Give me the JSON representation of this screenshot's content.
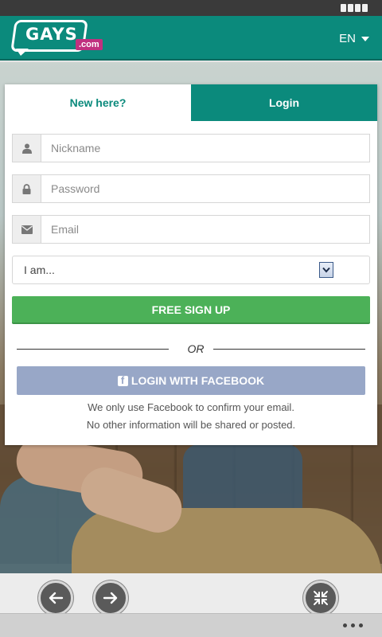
{
  "header": {
    "logo_text": "GAYS",
    "logo_suffix": ".com",
    "language": "EN"
  },
  "tabs": {
    "new_here": "New here?",
    "login": "Login"
  },
  "form": {
    "nickname_placeholder": "Nickname",
    "password_placeholder": "Password",
    "email_placeholder": "Email",
    "iam_selected": "I am...",
    "signup_label": "FREE SIGN UP",
    "or_label": "OR",
    "facebook_label": "LOGIN WITH FACEBOOK",
    "note_line1": "We only use Facebook to confirm your email.",
    "note_line2": "No other information will be shared or posted."
  },
  "colors": {
    "brand_teal": "#0b8a7c",
    "signup_green": "#4cb158",
    "facebook_blue": "#98a7c7",
    "logo_pink": "#c0307f"
  },
  "icons": {
    "nickname": "user-icon",
    "password": "lock-icon",
    "email": "envelope-icon",
    "back": "arrow-left-icon",
    "forward": "arrow-right-icon",
    "collapse": "collapse-icon",
    "menu": "more-dots-icon"
  }
}
